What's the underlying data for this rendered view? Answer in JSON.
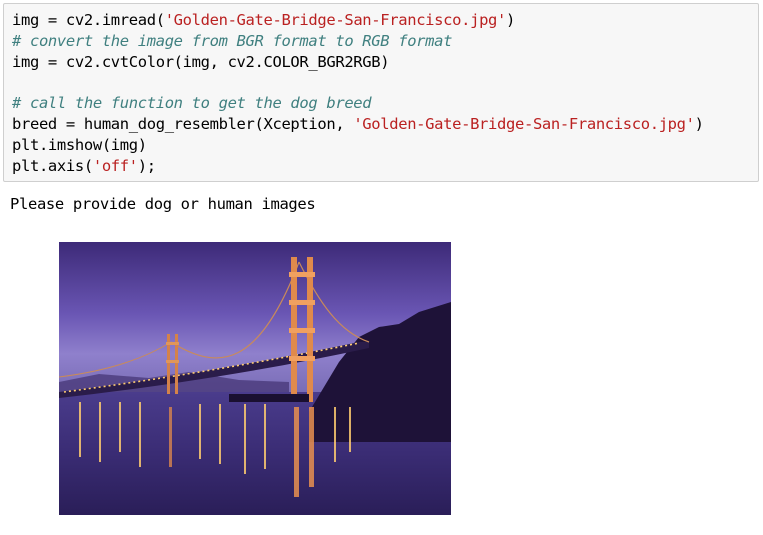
{
  "code_cell": {
    "lines": [
      [
        {
          "t": "plain",
          "v": "img = cv2.imread("
        },
        {
          "t": "str",
          "v": "'Golden-Gate-Bridge-San-Francisco.jpg'"
        },
        {
          "t": "plain",
          "v": ")"
        }
      ],
      [
        {
          "t": "comment",
          "v": "# convert the image from BGR format to RGB format"
        }
      ],
      [
        {
          "t": "plain",
          "v": "img = cv2.cvtColor(img, cv2.COLOR_BGR2RGB)"
        }
      ],
      [
        {
          "t": "plain",
          "v": ""
        }
      ],
      [
        {
          "t": "comment",
          "v": "# call the function to get the dog breed"
        }
      ],
      [
        {
          "t": "plain",
          "v": "breed = human_dog_resembler(Xception, "
        },
        {
          "t": "str",
          "v": "'Golden-Gate-Bridge-San-Francisco.jpg'"
        },
        {
          "t": "plain",
          "v": ")"
        }
      ],
      [
        {
          "t": "plain",
          "v": "plt.imshow(img)"
        }
      ],
      [
        {
          "t": "plain",
          "v": "plt.axis("
        },
        {
          "t": "str",
          "v": "'off'"
        },
        {
          "t": "plain",
          "v": ");"
        }
      ]
    ]
  },
  "output": {
    "stream_text": "Please provide dog or human images"
  },
  "colors": {
    "cell_background": "#f7f7f7",
    "cell_border": "#cfcfcf",
    "string_color": "#ba2121",
    "comment_color": "#408080"
  },
  "image": {
    "subject": "golden-gate-bridge-night-photo"
  }
}
